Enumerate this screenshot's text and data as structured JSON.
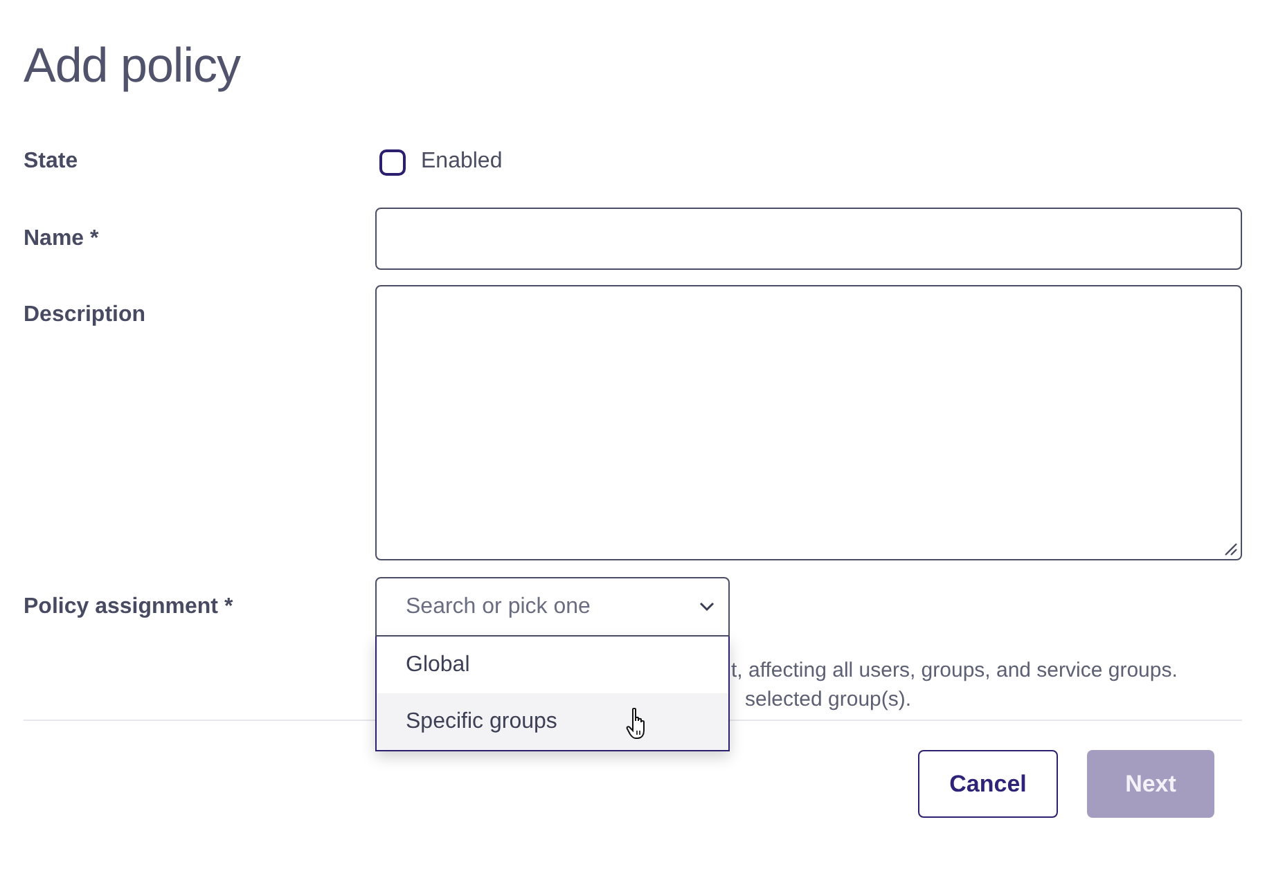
{
  "title": "Add policy",
  "fields": [
    {
      "kind": "checkbox",
      "label": "State",
      "option": "Enabled",
      "checked": false
    },
    {
      "kind": "text",
      "label": "Name *"
    },
    {
      "kind": "textarea",
      "label": "Description"
    },
    {
      "kind": "select",
      "label": "Policy assignment *",
      "placeholder": "Search or pick one",
      "expanded": true,
      "options": [
        {
          "label": "Global",
          "highlighted": false
        },
        {
          "label": "Specific groups",
          "highlighted": true
        }
      ],
      "help": [
        "t, affecting all users, groups, and service groups.",
        "selected group(s)."
      ]
    }
  ],
  "buttons": [
    {
      "label": "Cancel",
      "kind": "secondary",
      "disabled": false
    },
    {
      "label": "Next",
      "kind": "primary",
      "disabled": true
    }
  ]
}
